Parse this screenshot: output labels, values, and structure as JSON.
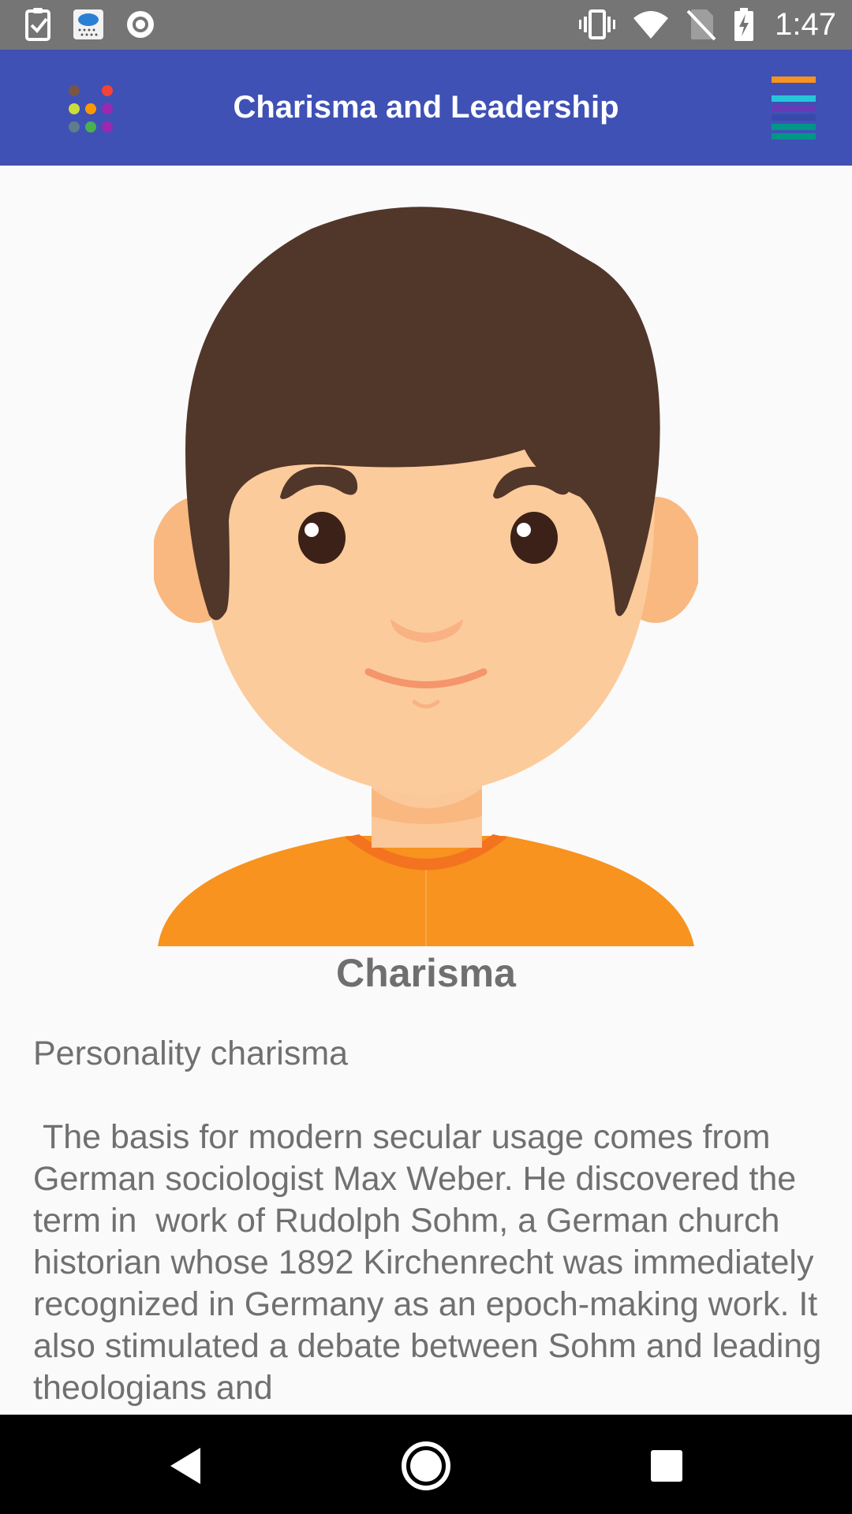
{
  "status_bar": {
    "time": "1:47",
    "left_icons": [
      "task-check-icon",
      "weather-app-icon",
      "record-circle-icon"
    ],
    "right_icons": [
      "vibrate-icon",
      "wifi-icon",
      "no-sim-icon",
      "battery-charging-icon"
    ]
  },
  "app_bar": {
    "title": "Charisma and Leadership",
    "logo_icon": "colored-dots-logo-icon",
    "menu_icon": "menu-icon",
    "colors": {
      "background": "#3f51b5",
      "menu_lines": [
        "#f7931e",
        "#26c6da",
        "#673ab7",
        "#009688"
      ]
    }
  },
  "content": {
    "image_icon": "boy-avatar-illustration",
    "title": "Charisma",
    "body": "Personality charisma\n\n The basis for modern secular usage comes from German sociologist Max Weber. He discovered the term in  work of Rudolph Sohm, a German church historian whose 1892 Kirchenrecht was immediately recognized in Germany as an epoch-making work. It also stimulated a debate between Sohm and leading theologians and"
  },
  "nav_bar": {
    "buttons": [
      "back-icon",
      "home-icon",
      "recents-icon"
    ]
  }
}
